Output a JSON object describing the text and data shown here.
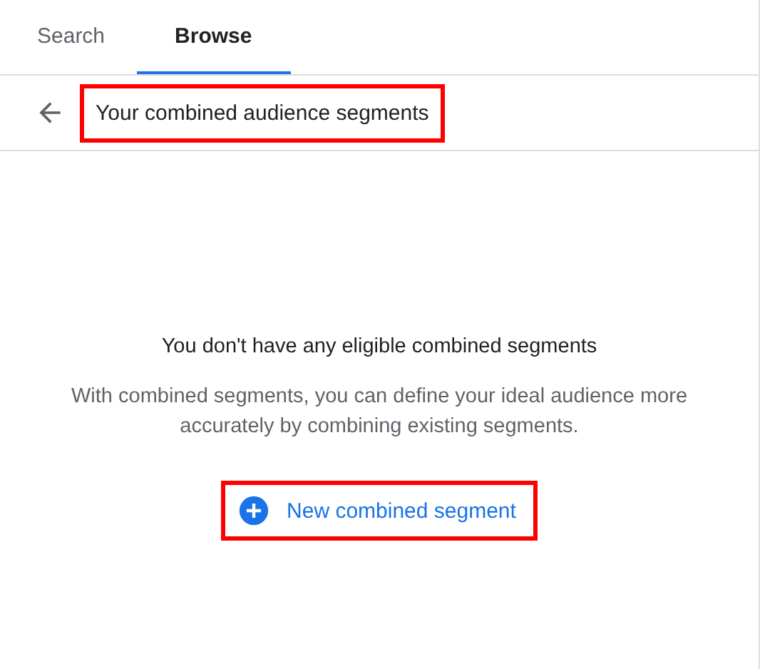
{
  "tabs": [
    {
      "label": "Search",
      "selected": false
    },
    {
      "label": "Browse",
      "selected": true
    }
  ],
  "header": {
    "title": "Your combined audience segments",
    "highlighted": true
  },
  "empty_state": {
    "heading": "You don't have any eligible combined segments",
    "description": "With combined segments, you can define your ideal audience more accurately by combining existing segments.",
    "button": {
      "label": "New combined segment",
      "highlighted": true
    }
  }
}
